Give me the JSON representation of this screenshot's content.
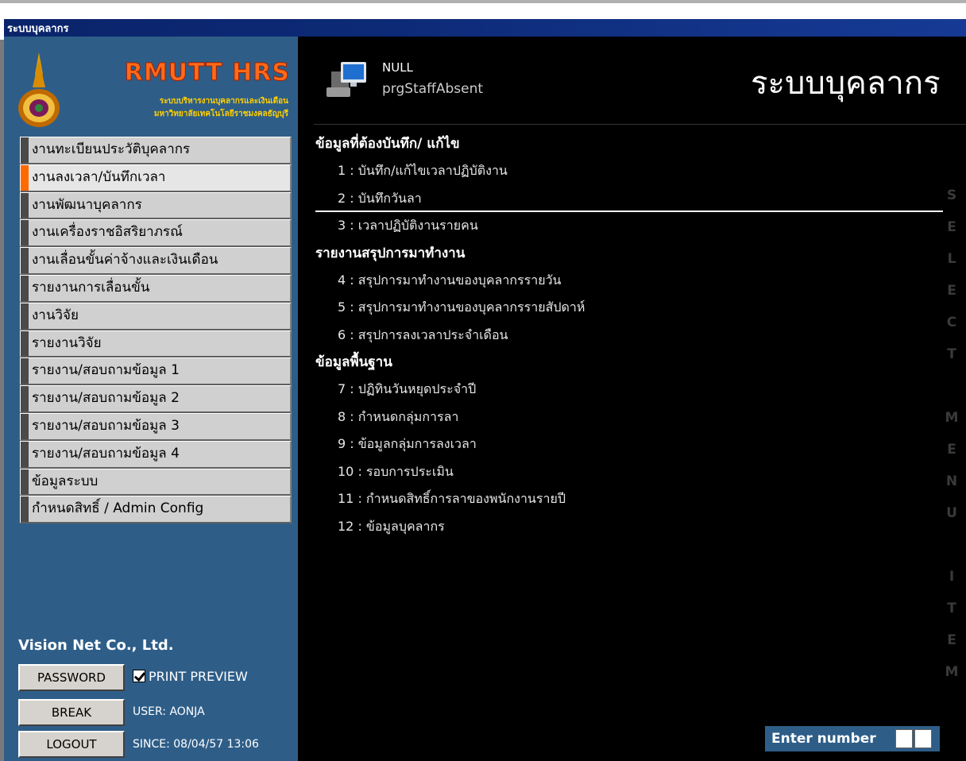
{
  "window": {
    "title": "ระบบบุคลากร"
  },
  "logo": {
    "title": "RMUTT HRS",
    "subtitle1": "ระบบบริหารงานบุคลากรและเงินเดือน",
    "subtitle2": "มหาวิทยาลัยเทคโนโลยีราชมงคลธัญบุรี"
  },
  "sidebar": {
    "items": [
      {
        "label": "งานทะเบียนประวัติบุคลากร",
        "active": false
      },
      {
        "label": "งานลงเวลา/บันทึกเวลา",
        "active": true
      },
      {
        "label": "งานพัฒนาบุคลากร",
        "active": false
      },
      {
        "label": "งานเครื่องราชอิสริยาภรณ์",
        "active": false
      },
      {
        "label": "งานเลื่อนขั้นค่าจ้างและเงินเดือน",
        "active": false
      },
      {
        "label": "รายงานการเลื่อนขั้น",
        "active": false
      },
      {
        "label": "งานวิจัย",
        "active": false
      },
      {
        "label": "รายงานวิจัย",
        "active": false
      },
      {
        "label": "รายงาน/สอบถามข้อมูล 1",
        "active": false
      },
      {
        "label": "รายงาน/สอบถามข้อมูล 2",
        "active": false
      },
      {
        "label": "รายงาน/สอบถามข้อมูล 3",
        "active": false
      },
      {
        "label": "รายงาน/สอบถามข้อมูล 4",
        "active": false
      },
      {
        "label": "ข้อมูลระบบ",
        "active": false
      },
      {
        "label": "กำหนดสิทธิ์ / Admin Config",
        "active": false
      }
    ],
    "company": "Vision Net Co., Ltd.",
    "password_label": "PASSWORD",
    "break_label": "BREAK",
    "logout_label": "LOGOUT",
    "print_preview_label": "PRINT PREVIEW",
    "print_preview_checked": true,
    "user": "USER: AONJA",
    "since": "SINCE: 08/04/57 13:06"
  },
  "header": {
    "null_text": "NULL",
    "program": "prgStaffAbsent",
    "system_title": "ระบบบุคลากร"
  },
  "sections": [
    {
      "heading": "ข้อมูลที่ต้องบันทึก/ แก้ไข",
      "items": [
        "1 : บันทึก/แก้ไขเวลาปฏิบัติงาน",
        "2 : บันทึกวันลา",
        "3 : เวลาปฏิบัติงานรายคน"
      ]
    },
    {
      "heading": "รายงานสรุปการมาทำงาน",
      "items": [
        "4 : สรุปการมาทำงานของบุคลากรรายวัน",
        "5 : สรุปการมาทำงานของบุคลากรรายสัปดาห์",
        "6 : สรุปการลงเวลาประจำเดือน"
      ]
    },
    {
      "heading": "ข้อมูลพื้นฐาน",
      "items": [
        "7 : ปฏิทินวันหยุดประจำปี",
        "8 : กำหนดกลุ่มการลา",
        "9 : ข้อมูลกลุ่มการลงเวลา",
        "10 : รอบการประเมิน",
        "11 : กำหนดสิทธิ์การลาของพนักงานรายปี",
        "12 : ข้อมูลบุคลากร"
      ]
    }
  ],
  "side_label": "SELECT MENU ITEM",
  "enter_number_label": "Enter number",
  "colors": {
    "sidebar_bg": "#2e5e88",
    "active_marker": "#ff6a00",
    "title_bar": "#0a246a"
  }
}
